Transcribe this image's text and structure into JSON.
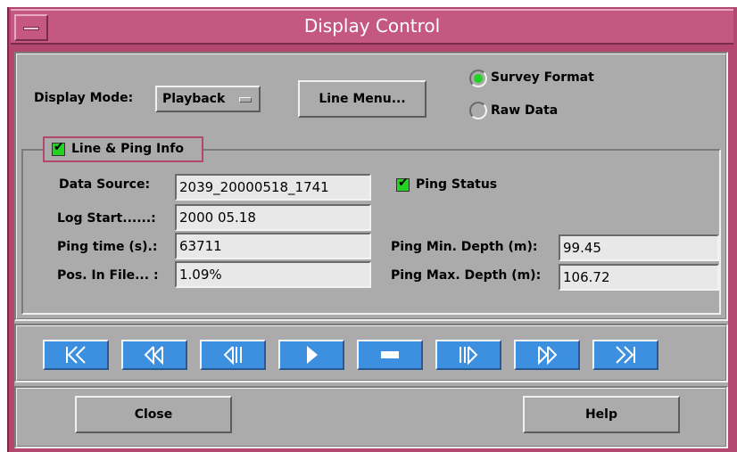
{
  "window": {
    "title": "Display Control"
  },
  "display_mode": {
    "label": "Display Mode:",
    "value": "Playback"
  },
  "buttons": {
    "line_menu": "Line Menu...",
    "close": "Close",
    "help": "Help"
  },
  "format": {
    "options": [
      {
        "label": "Survey Format",
        "selected": true
      },
      {
        "label": "Raw Data",
        "selected": false
      }
    ]
  },
  "line_ping_info": {
    "label": "Line & Ping Info",
    "checked": true,
    "fields": [
      {
        "label": "Data Source:",
        "value": "2039_20000518_1741"
      },
      {
        "label": "Log Start......:",
        "value": "2000 05.18"
      },
      {
        "label": "Ping time (s).:",
        "value": "63711"
      },
      {
        "label": "Pos. In File... :",
        "value": "1.09%"
      }
    ],
    "ping_status": {
      "label": "Ping Status",
      "checked": true
    },
    "depth_fields": [
      {
        "label": "Ping Min. Depth (m):",
        "value": "99.45"
      },
      {
        "label": "Ping Max. Depth (m):",
        "value": "106.72"
      }
    ]
  },
  "playback_controls": [
    "skip-to-start",
    "fast-rewind",
    "step-back",
    "play",
    "stop",
    "step-forward",
    "fast-forward",
    "skip-to-end"
  ],
  "colors": {
    "title_bar": "#c45880",
    "frame": "#b4476e",
    "panel": "#ababab",
    "nav_button": "#3d8fe0",
    "check_on": "#22d322"
  }
}
